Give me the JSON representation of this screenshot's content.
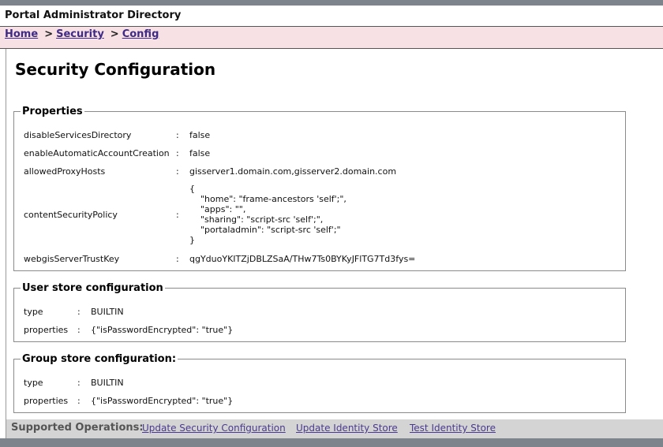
{
  "app_title": "Portal Administrator Directory",
  "breadcrumb": {
    "items": [
      "Home",
      "Security",
      "Config"
    ],
    "separator": ">"
  },
  "page_title": "Security Configuration",
  "properties": {
    "legend": "Properties",
    "rows": [
      {
        "key": "disableServicesDirectory",
        "value": "false"
      },
      {
        "key": "enableAutomaticAccountCreation",
        "value": "false"
      },
      {
        "key": "allowedProxyHosts",
        "value": "gisserver1.domain.com,gisserver2.domain.com"
      },
      {
        "key": "contentSecurityPolicy",
        "value": "{\n    \"home\": \"frame-ancestors 'self';\",\n    \"apps\": \"\",\n    \"sharing\": \"script-src 'self';\",\n    \"portaladmin\": \"script-src 'self';\"\n}"
      },
      {
        "key": "webgisServerTrustKey",
        "value": "qgYduoYKITZjDBLZSaA/THw7Ts0BYKyJFlTG7Td3fys="
      }
    ]
  },
  "user_store": {
    "legend": "User store configuration",
    "rows": [
      {
        "key": "type",
        "value": "BUILTIN"
      },
      {
        "key": "properties",
        "value": "{\"isPasswordEncrypted\": \"true\"}"
      }
    ]
  },
  "group_store": {
    "legend": "Group store configuration:",
    "rows": [
      {
        "key": "type",
        "value": "BUILTIN"
      },
      {
        "key": "properties",
        "value": "{\"isPasswordEncrypted\": \"true\"}"
      }
    ]
  },
  "colon": ":",
  "operations": {
    "label": "Supported Operations:",
    "links": [
      "Update Security Configuration",
      "Update Identity Store",
      "Test Identity Store"
    ]
  }
}
